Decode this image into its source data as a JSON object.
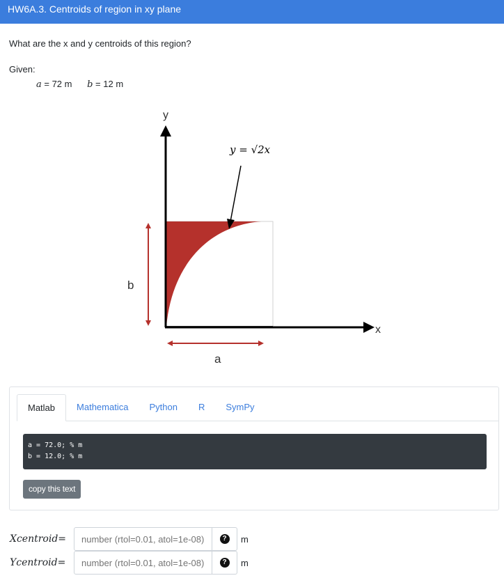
{
  "header": {
    "title": "HW6A.3. Centroids of region in xy plane"
  },
  "question": "What are the x and y centroids of this region?",
  "given": {
    "label": "Given:",
    "a_var": "a",
    "a_text": " = 72 m",
    "b_var": "b",
    "b_text": " = 12 m"
  },
  "figure": {
    "y_axis_label": "y",
    "x_axis_label": "x",
    "curve_label": "y = √2x",
    "a_label": "a",
    "b_label": "b",
    "region_color": "#b5312c"
  },
  "code": {
    "tabs": [
      "Matlab",
      "Mathematica",
      "Python",
      "R",
      "SymPy"
    ],
    "active_tab": "Matlab",
    "lines": [
      "a = 72.0; % m",
      "b = 12.0; % m"
    ],
    "copy_label": "copy this text"
  },
  "answers": [
    {
      "var": "Xcentroid",
      "eq": "=",
      "placeholder": "number (rtol=0.01, atol=1e-08)",
      "unit": "m",
      "help": "?"
    },
    {
      "var": "Ycentroid",
      "eq": "=",
      "placeholder": "number (rtol=0.01, atol=1e-08)",
      "unit": "m",
      "help": "?"
    }
  ]
}
